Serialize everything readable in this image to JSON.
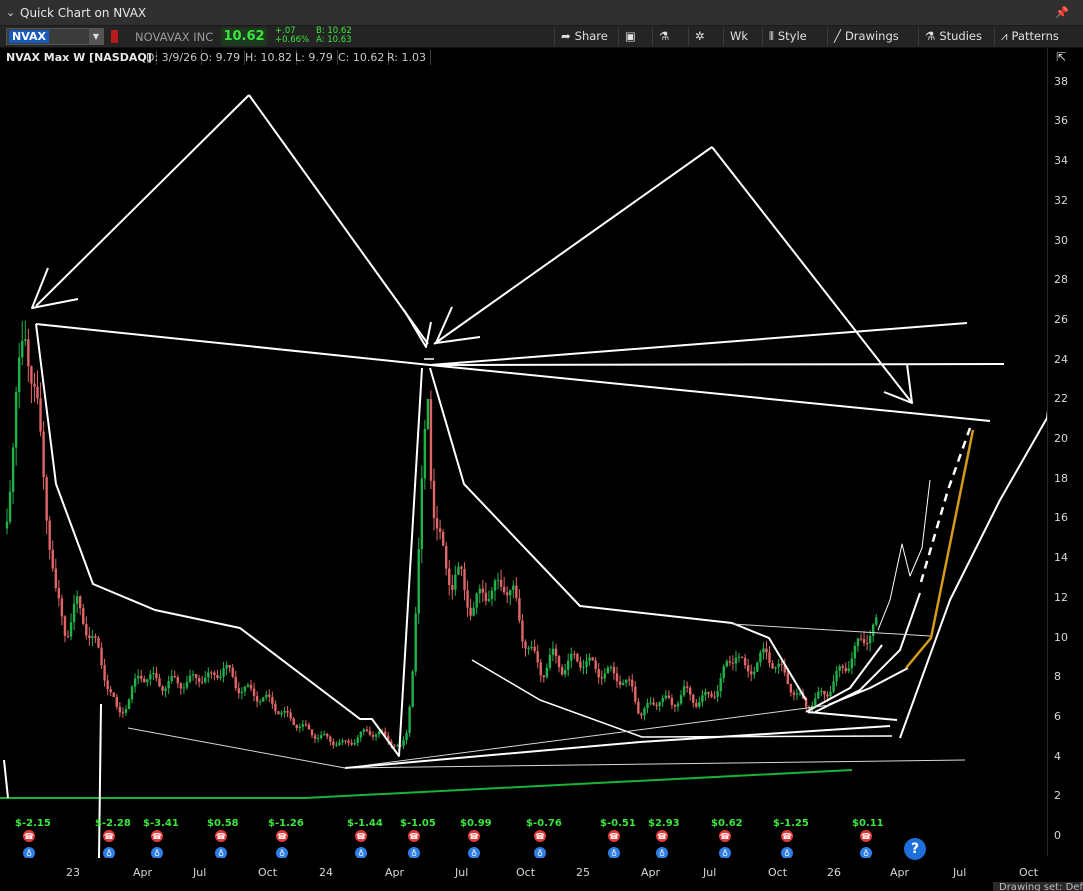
{
  "window": {
    "title": "Quick Chart on NVAX"
  },
  "quote": {
    "symbol": "NVAX",
    "company": "NOVAVAX INC",
    "last": "10.62",
    "change": "+.07",
    "change_pct": "+0.66%",
    "bid": "B: 10.62",
    "ask": "A: 10.63"
  },
  "toolbar": {
    "share": "Share",
    "period": "Wk",
    "style": "Style",
    "drawings": "Drawings",
    "studies": "Studies",
    "patterns": "Patterns"
  },
  "info": {
    "title": "NVAX Max W [NASDAQ]",
    "date": "D: 3/9/26",
    "open": "O: 9.79",
    "high": "H: 10.82",
    "low": "L: 9.79",
    "close": "C: 10.62",
    "range": "R: 1.03"
  },
  "y_axis": [
    "38",
    "36",
    "34",
    "32",
    "30",
    "28",
    "26",
    "24",
    "22",
    "20",
    "18",
    "16",
    "14",
    "12",
    "10",
    "8",
    "6",
    "4",
    "2",
    "0"
  ],
  "x_axis": [
    "23",
    "Apr",
    "Jul",
    "Oct",
    "24",
    "Apr",
    "Jul",
    "Oct",
    "25",
    "Apr",
    "Jul",
    "Oct",
    "26",
    "Apr",
    "Jul",
    "Oct"
  ],
  "earnings": [
    "$-2.15",
    "$-2.28",
    "$-3.41",
    "$0.58",
    "$-1.26",
    "$-1.44",
    "$-1.05",
    "$0.99",
    "$-0.76",
    "$-0.51",
    "$2.93",
    "$0.62",
    "$-1.25",
    "$0.11"
  ],
  "help": "?",
  "drawing_set": "Drawing set: Def",
  "colors": {
    "up": "#1fb34a",
    "down": "#e06666",
    "accent": "#1e6fd9",
    "drawing": "#ffffff",
    "trend": "#17b33a",
    "projection": "#d49a1a"
  }
}
